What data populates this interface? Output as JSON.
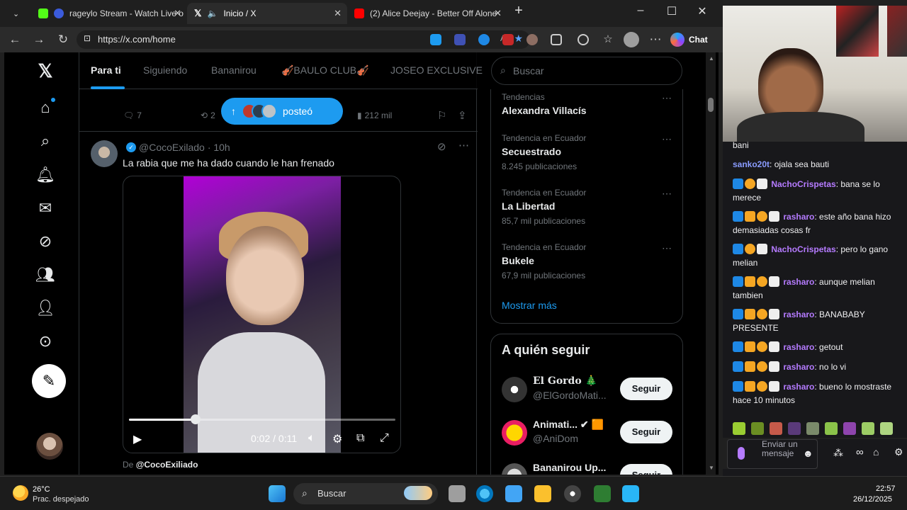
{
  "browser": {
    "tabs": [
      {
        "title": "rageylo Stream - Watch Live o",
        "active": false
      },
      {
        "title": "Inicio / X",
        "active": true
      },
      {
        "title": "(2) Alice Deejay - Better Off Alone",
        "active": false
      }
    ],
    "url": "https://x.com/home",
    "chat_label": "Chat"
  },
  "x": {
    "timeline_tabs": [
      "Para ti",
      "Siguiendo",
      "Bananirou",
      "🎻BAULO CLUB🎻",
      "JOSEO EXCLUSIVE"
    ],
    "prev_tweet_stats": {
      "replies": "7",
      "retweets": "2",
      "views": "212 mil"
    },
    "posted_pill": "posteó",
    "tweet": {
      "handle": "@CocoExilado",
      "time": "· 10h",
      "text": "La rabia que me ha dado cuando le han frenado",
      "video_time": "0:02 / 0:11",
      "progress_fraction": 0.25,
      "from_label": "De",
      "from_handle": "@CocoExiliado"
    },
    "search_placeholder": "Buscar",
    "trends": [
      {
        "context": "Tendencias",
        "name": "Alexandra Villacís",
        "count": ""
      },
      {
        "context": "Tendencia en Ecuador",
        "name": "Secuestrado",
        "count": "8.245 publicaciones"
      },
      {
        "context": "Tendencia en Ecuador",
        "name": "La Libertad",
        "count": "85,7 mil publicaciones"
      },
      {
        "context": "Tendencia en Ecuador",
        "name": "Bukele",
        "count": "67,9 mil publicaciones"
      }
    ],
    "show_more": "Mostrar más",
    "who_to_follow_title": "A quién seguir",
    "who_to_follow": [
      {
        "name": "El Gordo 🎄",
        "handle": "@ElGordoMati...",
        "button": "Seguir"
      },
      {
        "name": "Animati... ✔ 🟧",
        "handle": "@AniDom",
        "button": "Seguir"
      },
      {
        "name": "Bananirou Up...",
        "handle": "",
        "button": "Seguir"
      }
    ]
  },
  "twitch_chat": {
    "messages": [
      {
        "user": "",
        "text": "bani",
        "color": "#efeff1"
      },
      {
        "user": "sanko20t",
        "text": ": ojala sea bauti",
        "color": "#8a9cff"
      },
      {
        "user": "NachoCrispetas",
        "text": ": bana se lo merece",
        "color": "#b57bff"
      },
      {
        "user": "rasharo",
        "text": ": este año bana hizo demasiadas cosas fr",
        "color": "#b57bff"
      },
      {
        "user": "NachoCrispetas",
        "text": ": pero lo gano melian",
        "color": "#b57bff"
      },
      {
        "user": "rasharo",
        "text": ": aunque melian tambien",
        "color": "#b57bff"
      },
      {
        "user": "rasharo",
        "text": ": BANABABY PRESENTE",
        "color": "#b57bff"
      },
      {
        "user": "rasharo",
        "text": ": getout",
        "color": "#b57bff"
      },
      {
        "user": "rasharo",
        "text": ": no lo vi",
        "color": "#b57bff"
      },
      {
        "user": "rasharo",
        "text": ": bueno lo mostraste hace 10 minutos",
        "color": "#b57bff"
      }
    ],
    "input_placeholder": "Enviar un mensaje"
  },
  "taskbar": {
    "weather_temp": "26°C",
    "weather_desc": "Prac. despejado",
    "search_label": "Buscar",
    "time": "22:57",
    "date": "26/12/2025"
  }
}
